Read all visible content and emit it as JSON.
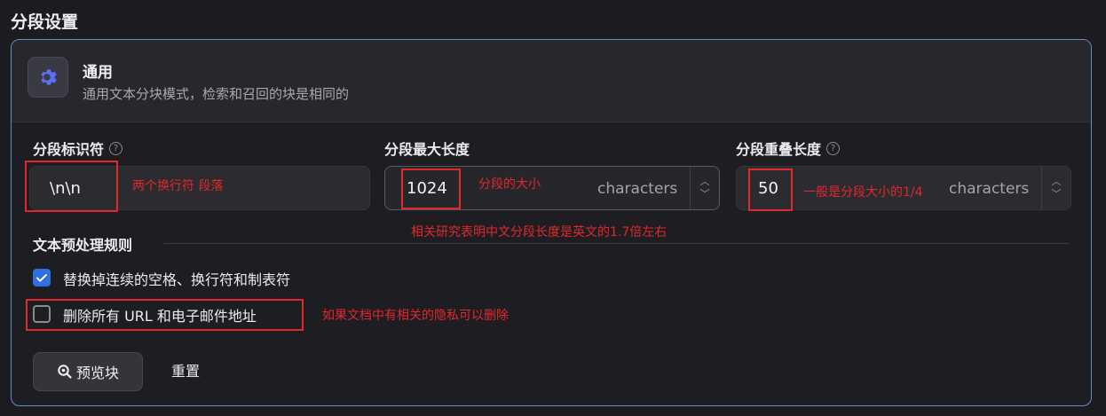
{
  "section": {
    "title": "分段设置"
  },
  "mode": {
    "title": "通用",
    "description": "通用文本分块模式，检索和召回的块是相同的",
    "icon": "gear-icon",
    "icon_color": "#5b6ef5"
  },
  "fields": {
    "delimiter": {
      "label": "分段标识符",
      "value": "\\n\\n"
    },
    "max_length": {
      "label": "分段最大长度",
      "value": "1024",
      "unit": "characters"
    },
    "overlap": {
      "label": "分段重叠长度",
      "value": "50",
      "unit": "characters"
    }
  },
  "preprocess": {
    "title": "文本预处理规则",
    "rules": [
      {
        "label": "替换掉连续的空格、换行符和制表符",
        "checked": true
      },
      {
        "label": "删除所有 URL 和电子邮件地址",
        "checked": false
      }
    ]
  },
  "buttons": {
    "preview": "预览块",
    "reset": "重置"
  },
  "annotations": {
    "delimiter_note": "两个换行符 段落",
    "max_length_note": "分段的大小",
    "overlap_note": "一般是分段大小的1/4",
    "ratio_note": "相关研究表明中文分段长度是英文的1.7倍左右",
    "privacy_note": "如果文档中有相关的隐私可以删除",
    "color": "#e0282e"
  }
}
